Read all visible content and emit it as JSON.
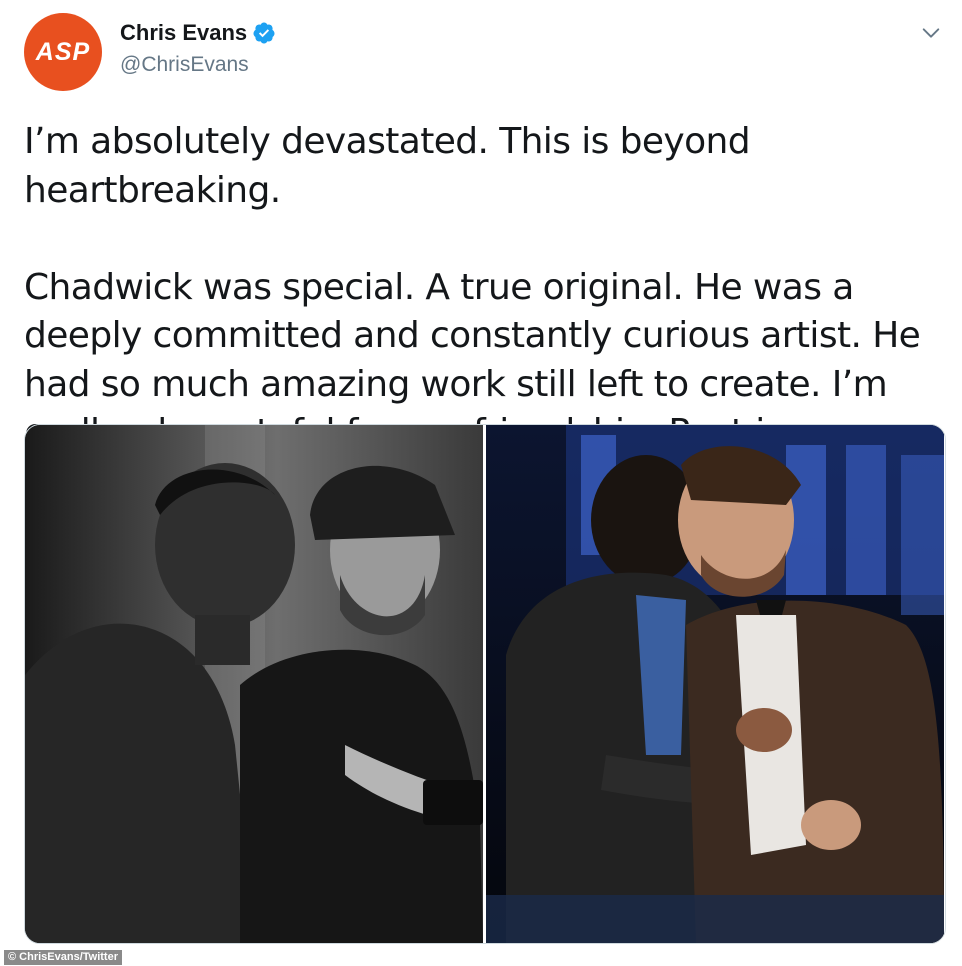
{
  "author": {
    "avatar_text": "ASP",
    "name": "Chris Evans",
    "handle": "@ChrisEvans",
    "verified_icon": "verified-badge-icon"
  },
  "menu_icon": "chevron-down-icon",
  "tweet": {
    "paragraph1": "I’m absolutely devastated. This is beyond heartbreaking.",
    "paragraph2": "Chadwick was special. A true original. He was a deeply committed and constantly curious artist. He had so much amazing work still left to create. I’m endlessly grateful for our friendship. Rest in power, King",
    "emoji": "blue-heart-icon"
  },
  "media": {
    "photos": [
      {
        "description_icon": "photo-black-and-white"
      },
      {
        "description_icon": "photo-stage-embrace"
      }
    ]
  },
  "credit": "© ChrisEvans/Twitter",
  "colors": {
    "avatar_bg": "#e8501f",
    "verified": "#1da1f2",
    "heart": "#5dadec",
    "handle": "#657786",
    "text": "#14171a"
  }
}
